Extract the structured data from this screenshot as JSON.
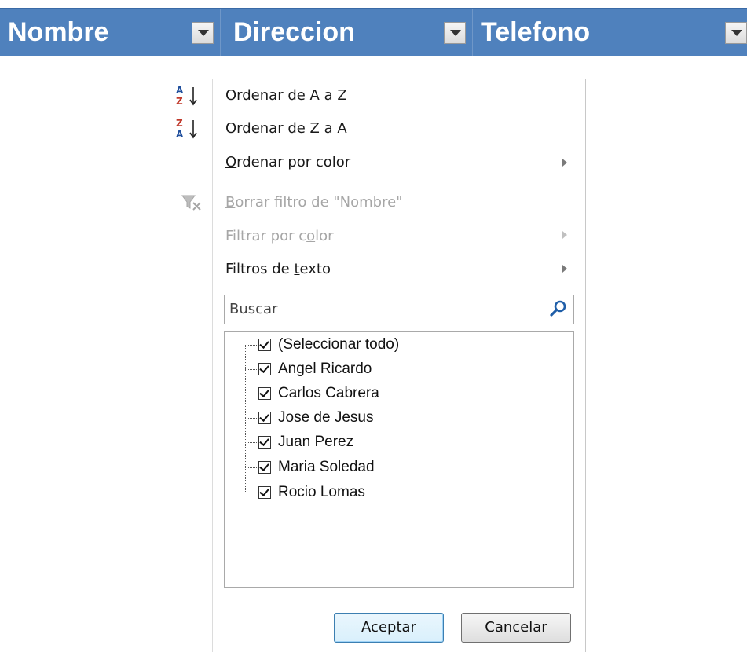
{
  "header": {
    "columns": [
      {
        "label": "Nombre"
      },
      {
        "label": "Direccion"
      },
      {
        "label": "Telefono"
      }
    ],
    "accent": "#4f81bd"
  },
  "menu": {
    "sort_az": {
      "pre": "Ordenar ",
      "u": "d",
      "post": "e A a Z",
      "icon": "sort-az-icon"
    },
    "sort_za": {
      "pre": "O",
      "u": "r",
      "post": "denar de Z a A",
      "icon": "sort-za-icon"
    },
    "sort_color": {
      "pre": "",
      "u": "O",
      "post": "rdenar por color"
    },
    "clear_filter": {
      "pre": "",
      "u": "B",
      "post": "orrar filtro de \"Nombre\"",
      "icon": "clear-filter-icon"
    },
    "filter_color": {
      "pre": "Filtrar por c",
      "u": "o",
      "post": "lor"
    },
    "text_filters": {
      "pre": "Filtros de ",
      "u": "t",
      "post": "exto"
    }
  },
  "search": {
    "placeholder": "Buscar",
    "icon": "search-icon"
  },
  "values": [
    {
      "label": "(Seleccionar todo)",
      "checked": true
    },
    {
      "label": "Angel Ricardo",
      "checked": true
    },
    {
      "label": "Carlos Cabrera",
      "checked": true
    },
    {
      "label": "Jose de Jesus",
      "checked": true
    },
    {
      "label": "Juan Perez",
      "checked": true
    },
    {
      "label": "Maria Soledad",
      "checked": true
    },
    {
      "label": "Rocio Lomas",
      "checked": true
    }
  ],
  "buttons": {
    "ok": "Aceptar",
    "cancel": "Cancelar"
  }
}
